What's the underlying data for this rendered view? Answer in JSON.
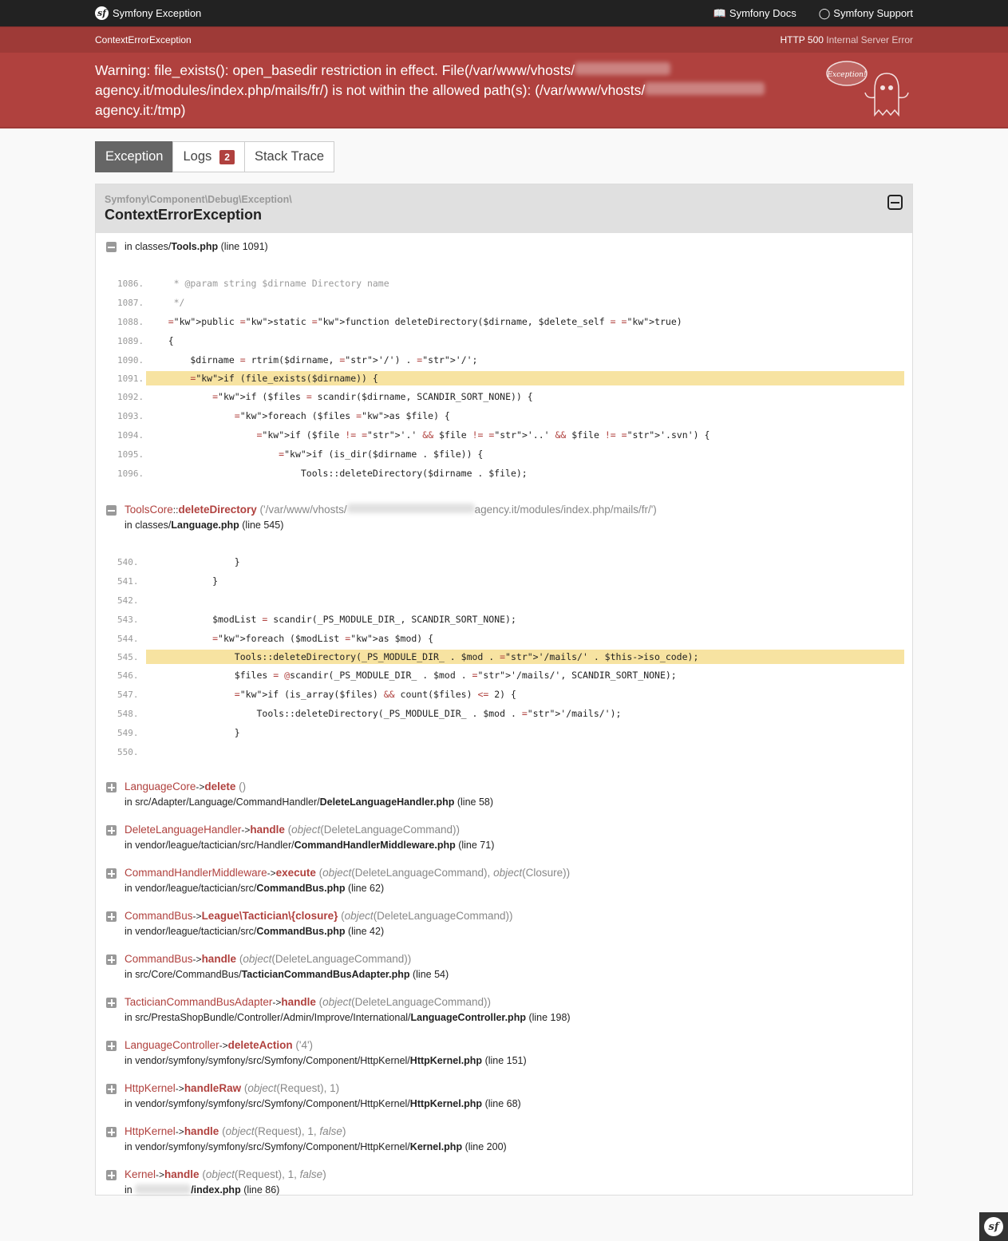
{
  "header": {
    "brand": "Symfony Exception",
    "docs_label": "Symfony Docs",
    "support_label": "Symfony Support"
  },
  "summary": {
    "exception_class": "ContextErrorException",
    "status_code": "HTTP 500",
    "status_text": "Internal Server Error",
    "message_part1": "Warning: file_exists(): open_basedir restriction in effect. File(/var/www/vhosts/",
    "message_part2": "agency.it/modules/index.php/mails/fr/) is not within the allowed path(s): (/var/www/vhosts/",
    "message_part3": "agency.it:/tmp)",
    "ghost_label": "Exception!"
  },
  "tabs": {
    "exception": "Exception",
    "logs": "Logs",
    "logs_count": "2",
    "stack_trace": "Stack Trace"
  },
  "trace": {
    "namespace": "Symfony\\Component\\Debug\\Exception\\",
    "class": "ContextErrorException",
    "frame0": {
      "in": "in classes/",
      "file": "Tools.php",
      "line": "(line 1091)"
    },
    "frame1": {
      "class": "ToolsCore",
      "op": "::",
      "fn": "deleteDirectory",
      "arg_prefix": "('/var/www/vhosts/",
      "arg_suffix": "agency.it/modules/index.php/mails/fr/')",
      "in": "in classes/",
      "file": "Language.php",
      "line": "(line 545)"
    },
    "frames": [
      {
        "class": "LanguageCore",
        "op": "->",
        "fn": "delete",
        "args": "()",
        "in": "in src/Adapter/Language/CommandHandler/",
        "file": "DeleteLanguageHandler.php",
        "line": "(line 58)"
      },
      {
        "class": "DeleteLanguageHandler",
        "op": "->",
        "fn": "handle",
        "args": "(object(DeleteLanguageCommand))",
        "in": "in vendor/league/tactician/src/Handler/",
        "file": "CommandHandlerMiddleware.php",
        "line": "(line 71)"
      },
      {
        "class": "CommandHandlerMiddleware",
        "op": "->",
        "fn": "execute",
        "args": "(object(DeleteLanguageCommand), object(Closure))",
        "in": "in vendor/league/tactician/src/",
        "file": "CommandBus.php",
        "line": "(line 62)"
      },
      {
        "class": "CommandBus",
        "op": "->",
        "fn": "League\\Tactician\\{closure}",
        "args": "(object(DeleteLanguageCommand))",
        "in": "in vendor/league/tactician/src/",
        "file": "CommandBus.php",
        "line": "(line 42)"
      },
      {
        "class": "CommandBus",
        "op": "->",
        "fn": "handle",
        "args": "(object(DeleteLanguageCommand))",
        "in": "in src/Core/CommandBus/",
        "file": "TacticianCommandBusAdapter.php",
        "line": "(line 54)"
      },
      {
        "class": "TacticianCommandBusAdapter",
        "op": "->",
        "fn": "handle",
        "args": "(object(DeleteLanguageCommand))",
        "in": "in src/PrestaShopBundle/Controller/Admin/Improve/International/",
        "file": "LanguageController.php",
        "line": "(line 198)"
      },
      {
        "class": "LanguageController",
        "op": "->",
        "fn": "deleteAction",
        "args": "('4')",
        "in": "in vendor/symfony/symfony/src/Symfony/Component/HttpKernel/",
        "file": "HttpKernel.php",
        "line": "(line 151)"
      },
      {
        "class": "HttpKernel",
        "op": "->",
        "fn": "handleRaw",
        "args": "(object(Request), 1)",
        "in": "in vendor/symfony/symfony/src/Symfony/Component/HttpKernel/",
        "file": "HttpKernel.php",
        "line": "(line 68)"
      },
      {
        "class": "HttpKernel",
        "op": "->",
        "fn": "handle",
        "args": "(object(Request), 1, false)",
        "in": "in vendor/symfony/symfony/src/Symfony/Component/HttpKernel/",
        "file": "Kernel.php",
        "line": "(line 200)"
      },
      {
        "class": "Kernel",
        "op": "->",
        "fn": "handle",
        "args": "(object(Request), 1, false)",
        "in": "in ",
        "file": "/index.php",
        "line": "(line 86)"
      }
    ]
  },
  "code0": [
    {
      "n": "1086.",
      "t": "     * @param string $dirname Directory name",
      "hl": false
    },
    {
      "n": "1087.",
      "t": "     */",
      "hl": false
    },
    {
      "n": "1088.",
      "t": "    public static function deleteDirectory($dirname, $delete_self = true)",
      "hl": false
    },
    {
      "n": "1089.",
      "t": "    {",
      "hl": false
    },
    {
      "n": "1090.",
      "t": "        $dirname = rtrim($dirname, '/') . '/';",
      "hl": false
    },
    {
      "n": "1091.",
      "t": "        if (file_exists($dirname)) {",
      "hl": true
    },
    {
      "n": "1092.",
      "t": "            if ($files = scandir($dirname, SCANDIR_SORT_NONE)) {",
      "hl": false
    },
    {
      "n": "1093.",
      "t": "                foreach ($files as $file) {",
      "hl": false
    },
    {
      "n": "1094.",
      "t": "                    if ($file != '.' && $file != '..' && $file != '.svn') {",
      "hl": false
    },
    {
      "n": "1095.",
      "t": "                        if (is_dir($dirname . $file)) {",
      "hl": false
    },
    {
      "n": "1096.",
      "t": "                            Tools::deleteDirectory($dirname . $file);",
      "hl": false
    }
  ],
  "code1": [
    {
      "n": "540.",
      "t": "                }",
      "hl": false
    },
    {
      "n": "541.",
      "t": "            }",
      "hl": false
    },
    {
      "n": "542.",
      "t": "",
      "hl": false
    },
    {
      "n": "543.",
      "t": "            $modList = scandir(_PS_MODULE_DIR_, SCANDIR_SORT_NONE);",
      "hl": false
    },
    {
      "n": "544.",
      "t": "            foreach ($modList as $mod) {",
      "hl": false
    },
    {
      "n": "545.",
      "t": "                Tools::deleteDirectory(_PS_MODULE_DIR_ . $mod . '/mails/' . $this->iso_code);",
      "hl": true
    },
    {
      "n": "546.",
      "t": "                $files = @scandir(_PS_MODULE_DIR_ . $mod . '/mails/', SCANDIR_SORT_NONE);",
      "hl": false
    },
    {
      "n": "547.",
      "t": "                if (is_array($files) && count($files) <= 2) {",
      "hl": false
    },
    {
      "n": "548.",
      "t": "                    Tools::deleteDirectory(_PS_MODULE_DIR_ . $mod . '/mails/');",
      "hl": false
    },
    {
      "n": "549.",
      "t": "                }",
      "hl": false
    },
    {
      "n": "550.",
      "t": "",
      "hl": false
    }
  ]
}
